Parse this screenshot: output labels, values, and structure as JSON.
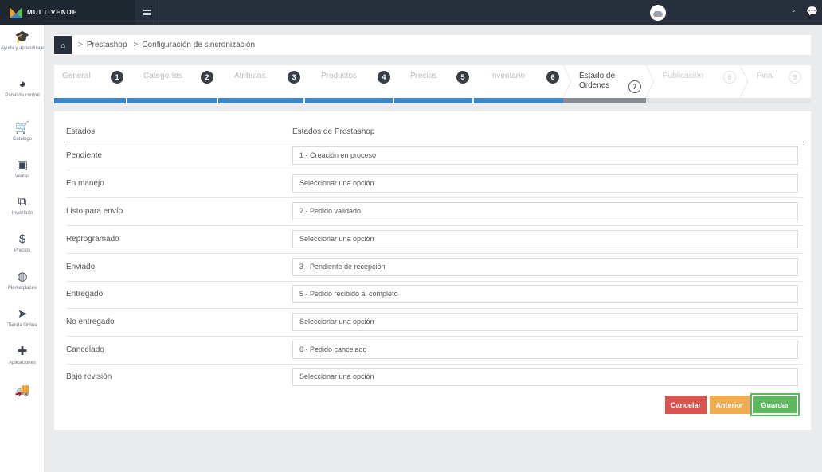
{
  "app": {
    "brand": "MULTIVENDE",
    "colors": {
      "topbar": "#262f3b",
      "accent_blue": "#3d85c6",
      "cancel": "#d9534f",
      "previous": "#f0ad4e",
      "save": "#5cb85c"
    }
  },
  "sidebar": {
    "items": [
      {
        "label": "Ayuda y aprendizaje",
        "icon": "graduation-cap-icon"
      },
      {
        "label": "Panel de control",
        "icon": "dashboard-icon"
      },
      {
        "label": "Catálogo",
        "icon": "cart-icon"
      },
      {
        "label": "Ventas",
        "icon": "money-icon"
      },
      {
        "label": "Inventario",
        "icon": "cubes-icon"
      },
      {
        "label": "Precios",
        "icon": "dollar-icon"
      },
      {
        "label": "Marketplaces",
        "icon": "globe-icon"
      },
      {
        "label": "Tienda Online",
        "icon": "cursor-icon"
      },
      {
        "label": "Aplicaciones",
        "icon": "puzzle-icon"
      },
      {
        "label": "",
        "icon": "truck-icon"
      }
    ]
  },
  "breadcrumb": {
    "items": [
      "Prestashop",
      "Configuración de sincronización"
    ]
  },
  "wizard": {
    "steps": [
      {
        "label": "General",
        "num": "1"
      },
      {
        "label": "Categorías",
        "num": "2"
      },
      {
        "label": "Atributos",
        "num": "3"
      },
      {
        "label": "Productos",
        "num": "4"
      },
      {
        "label": "Precios",
        "num": "5"
      },
      {
        "label": "Inventario",
        "num": "6"
      },
      {
        "label_line1": "Estado de",
        "label_line2": "Ordenes",
        "num": "7"
      },
      {
        "label": "Publicación",
        "num": "8"
      },
      {
        "label": "Final",
        "num": "9"
      }
    ]
  },
  "table": {
    "col_states": "Estados",
    "col_prestashop": "Estados de Prestashop",
    "rows": [
      {
        "state": "Pendiente",
        "value": "1 - Creación en proceso"
      },
      {
        "state": "En manejo",
        "value": "Seleccionar una opción"
      },
      {
        "state": "Listo para envío",
        "value": "2 - Pedido validado"
      },
      {
        "state": "Reprogramado",
        "value": "Seleccionar una opción"
      },
      {
        "state": "Enviado",
        "value": "3 - Pendiente de recepción"
      },
      {
        "state": "Entregado",
        "value": "5 - Pedido recibido al completo"
      },
      {
        "state": "No entregado",
        "value": "Seleccionar una opción"
      },
      {
        "state": "Cancelado",
        "value": "6 - Pedido cancelado"
      },
      {
        "state": "Bajo revisión",
        "value": "Seleccionar una opción"
      }
    ]
  },
  "actions": {
    "cancel": "Cancelar",
    "previous": "Anterior",
    "save": "Guardar"
  }
}
